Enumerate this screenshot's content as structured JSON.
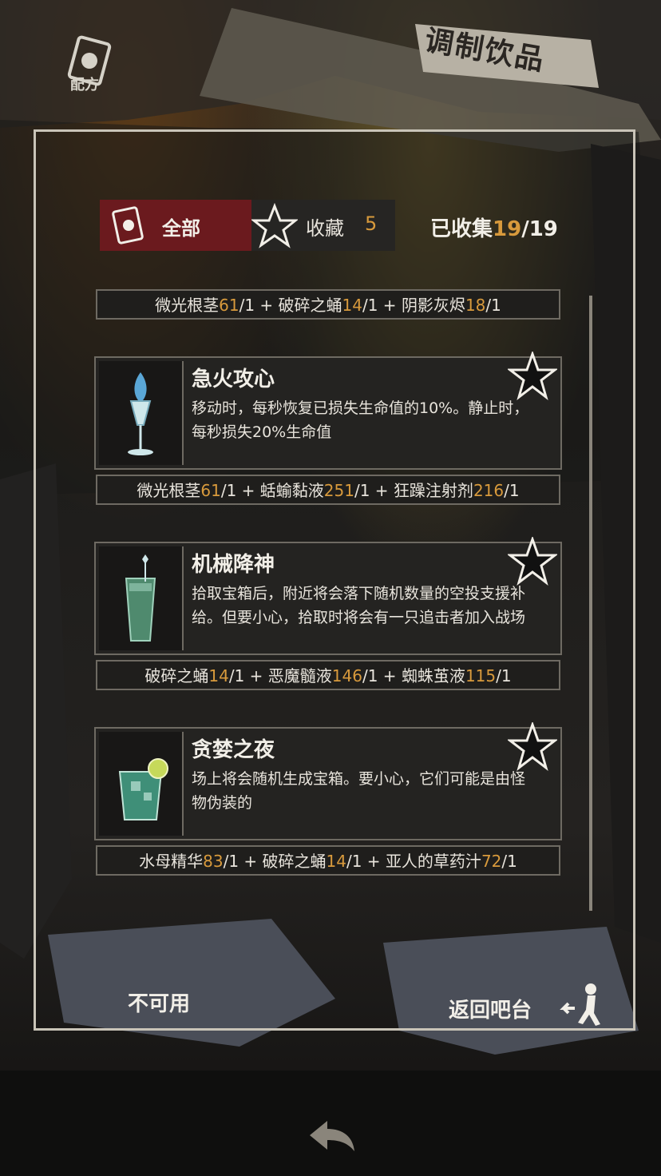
{
  "header": {
    "recipe_label": "配方",
    "title": "调制饮品"
  },
  "tabs": {
    "all_label": "全部",
    "favorites_label": "收藏",
    "favorites_count": "5",
    "collected_label": "已收集",
    "collected_current": "19",
    "collected_total": "/19"
  },
  "recipes": [
    {
      "ingredients": [
        {
          "name": "微光根茎",
          "count": "61",
          "need": "/1"
        },
        {
          "name": "破碎之蛹",
          "count": "14",
          "need": "/1"
        },
        {
          "name": "阴影灰烬",
          "count": "18",
          "need": "/1"
        }
      ]
    },
    {
      "name": "急火攻心",
      "icon": "flaming-glass-icon",
      "description": "移动时，每秒恢复已损失生命值的10%。静止时，每秒损失20%生命值",
      "ingredients": [
        {
          "name": "微光根茎",
          "count": "61",
          "need": "/1"
        },
        {
          "name": "蛞蝓黏液",
          "count": "251",
          "need": "/1"
        },
        {
          "name": "狂躁注射剂",
          "count": "216",
          "need": "/1"
        }
      ]
    },
    {
      "name": "机械降神",
      "icon": "tall-glass-icon",
      "description": "拾取宝箱后，附近将会落下随机数量的空投支援补给。但要小心，拾取时将会有一只追击者加入战场",
      "ingredients": [
        {
          "name": "破碎之蛹",
          "count": "14",
          "need": "/1"
        },
        {
          "name": "恶魔髓液",
          "count": "146",
          "need": "/1"
        },
        {
          "name": "蜘蛛茧液",
          "count": "115",
          "need": "/1"
        }
      ]
    },
    {
      "name": "贪婪之夜",
      "icon": "lime-tumbler-icon",
      "description": "场上将会随机生成宝箱。要小心，它们可能是由怪物伪装的",
      "ingredients": [
        {
          "name": "水母精华",
          "count": "83",
          "need": "/1"
        },
        {
          "name": "破碎之蛹",
          "count": "14",
          "need": "/1"
        },
        {
          "name": "亚人的草药汁",
          "count": "72",
          "need": "/1"
        }
      ]
    }
  ],
  "buttons": {
    "unavailable_label": "不可用",
    "return_label": "返回吧台"
  },
  "colors": {
    "accent": "#d89a3c",
    "tab_active": "#6b1a1e"
  }
}
